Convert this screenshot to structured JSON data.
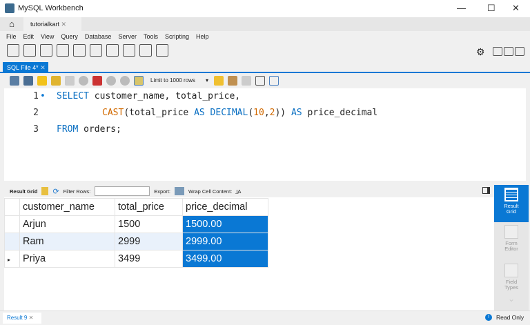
{
  "window": {
    "title": "MySQL Workbench",
    "minimize": "—",
    "maximize": "☐",
    "close": "✕"
  },
  "tabs": {
    "home_icon": "home-icon",
    "connection": "tutorialkart",
    "close": "✕"
  },
  "menu": [
    "File",
    "Edit",
    "View",
    "Query",
    "Database",
    "Server",
    "Tools",
    "Scripting",
    "Help"
  ],
  "sql_tab": {
    "label": "SQL File 4*",
    "close": "✕"
  },
  "editor_toolbar": {
    "limit": "Limit to 1000 rows"
  },
  "editor": {
    "lines": [
      {
        "n": "1",
        "dot": "•"
      },
      {
        "n": "2"
      },
      {
        "n": "3"
      }
    ],
    "code": {
      "l1_kw": "SELECT",
      "l1_rest": " customer_name, total_price,",
      "l2_fn": "CAST",
      "l2_a": "(total_price ",
      "l2_as": "AS",
      "l2_dec": " DECIMAL",
      "l2_b": "(",
      "l2_n1": "10",
      "l2_c": ",",
      "l2_n2": "2",
      "l2_d": ")) ",
      "l2_as2": "AS",
      "l2_e": " price_decimal",
      "l3_kw": "FROM",
      "l3_rest": " orders;"
    }
  },
  "results_toolbar": {
    "result_grid": "Result Grid",
    "filter_rows": "Filter Rows:",
    "filter_value": "",
    "export": "Export:",
    "wrap": "Wrap Cell Content:"
  },
  "grid": {
    "columns": [
      "customer_name",
      "total_price",
      "price_decimal"
    ],
    "rows": [
      [
        "Arjun",
        "1500",
        "1500.00"
      ],
      [
        "Ram",
        "2999",
        "2999.00"
      ],
      [
        "Priya",
        "3499",
        "3499.00"
      ]
    ]
  },
  "side_panel": {
    "result_grid": "Result Grid",
    "form_editor": "Form Editor",
    "field_types": "Field Types"
  },
  "status": {
    "result_tab": "Result 9",
    "close": "✕",
    "read_only": "Read Only"
  },
  "colors": {
    "accent": "#0a78d4"
  }
}
